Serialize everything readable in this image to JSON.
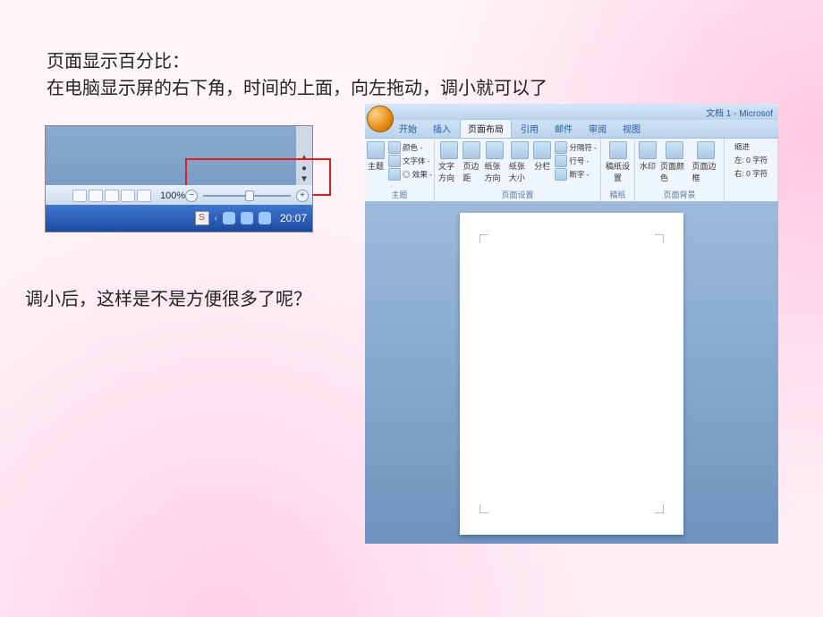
{
  "text": {
    "line1": "页面显示百分比：",
    "line2": "在电脑显示屏的右下角，时间的上面，向左拖动，调小就可以了",
    "line3": "调小后，这样是不是方便很多了呢？"
  },
  "statusbar": {
    "zoom_pct": "100%",
    "minus": "−",
    "plus": "+",
    "clock": "20:07",
    "ime": "S"
  },
  "word": {
    "title": "文档 1 - Microsof",
    "tabs": [
      "开始",
      "插入",
      "页面布局",
      "引用",
      "邮件",
      "审阅",
      "视图"
    ],
    "active_tab_index": 2,
    "groups": {
      "theme": {
        "label": "主题",
        "main": "主题",
        "sub": [
          "颜色 -",
          "文字体 -",
          "◎ 效果 -"
        ]
      },
      "page_setup": {
        "label": "页面设置",
        "btns": [
          "文字方向",
          "页边距",
          "纸张方向",
          "纸张大小",
          "分栏"
        ],
        "sub": [
          "分隔符 -",
          "行号 -",
          "断字 -"
        ]
      },
      "paper": {
        "label": "稿纸",
        "btn": "稿纸设置"
      },
      "page_bg": {
        "label": "页面背景",
        "btns": [
          "水印",
          "页面颜色",
          "页面边框"
        ]
      },
      "paragraph": {
        "label": "缩进",
        "left_lbl": "左: 0 字符",
        "right_lbl": "右: 0 字符"
      }
    }
  }
}
